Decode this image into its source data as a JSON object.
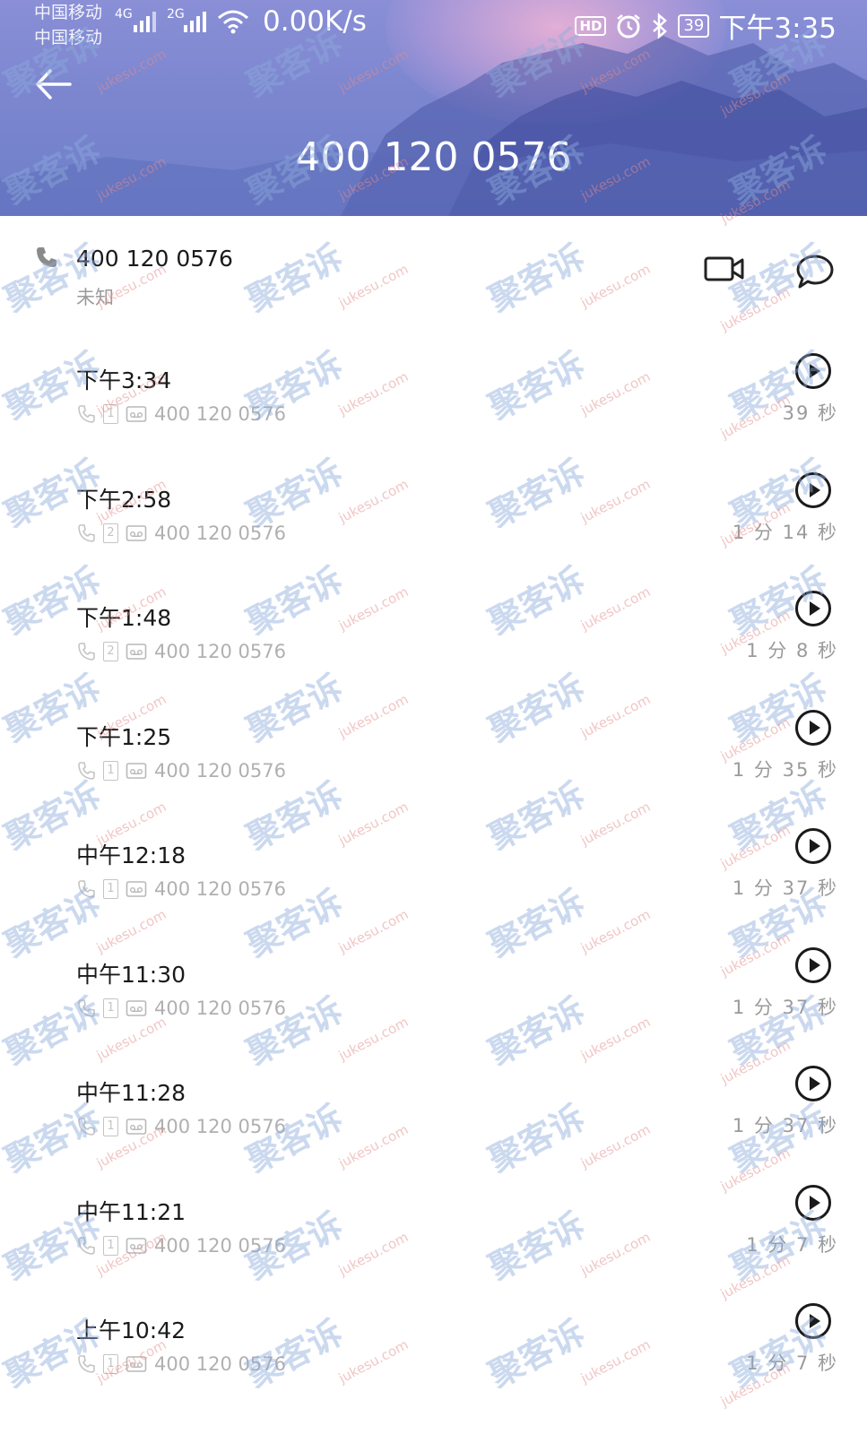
{
  "status_bar": {
    "carrier_1": "中国移动",
    "carrier_2": "中国移动",
    "net_1": "4G",
    "net_2": "2G",
    "speed": "0.00K/s",
    "battery": "39",
    "time": "下午3:35",
    "hd": "HD"
  },
  "header": {
    "title": "400 120 0576"
  },
  "contact": {
    "number": "400 120 0576",
    "location": "未知"
  },
  "calls": [
    {
      "time": "下午3:34",
      "number": "400 120 0576",
      "sim": "1",
      "duration": "39 秒"
    },
    {
      "time": "下午2:58",
      "number": "400 120 0576",
      "sim": "2",
      "duration": "1 分 14 秒"
    },
    {
      "time": "下午1:48",
      "number": "400 120 0576",
      "sim": "2",
      "duration": "1 分 8 秒"
    },
    {
      "time": "下午1:25",
      "number": "400 120 0576",
      "sim": "1",
      "duration": "1 分 35 秒"
    },
    {
      "time": "中午12:18",
      "number": "400 120 0576",
      "sim": "1",
      "duration": "1 分 37 秒"
    },
    {
      "time": "中午11:30",
      "number": "400 120 0576",
      "sim": "1",
      "duration": "1 分 37 秒"
    },
    {
      "time": "中午11:28",
      "number": "400 120 0576",
      "sim": "1",
      "duration": "1 分 37 秒"
    },
    {
      "time": "中午11:21",
      "number": "400 120 0576",
      "sim": "1",
      "duration": "1 分 7 秒"
    },
    {
      "time": "上午10:42",
      "number": "400 120 0576",
      "sim": "1",
      "duration": "1 分 7 秒"
    }
  ],
  "watermark": {
    "cn": "聚客诉",
    "en": "jukesu.com"
  },
  "colors": {
    "header_top": "#8a8fd6",
    "header_bottom": "#6f7fc9",
    "text_primary": "#1a1a1a",
    "text_secondary": "#9a9a9a"
  }
}
